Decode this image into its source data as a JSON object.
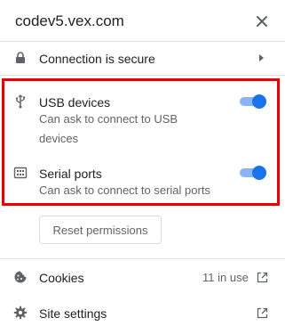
{
  "header": {
    "site": "codev5.vex.com"
  },
  "connection": {
    "label": "Connection is secure"
  },
  "permissions": [
    {
      "label": "USB devices",
      "description_line1": "Can ask to connect to USB",
      "description_line2": "devices",
      "enabled": true,
      "icon": "usb-icon"
    },
    {
      "label": "Serial ports",
      "description_line1": "Can ask to connect to serial ports",
      "enabled": true,
      "icon": "serial-port-icon"
    }
  ],
  "reset": {
    "label": "Reset permissions"
  },
  "cookies": {
    "label": "Cookies",
    "count": "11 in use",
    "icon": "cookie-icon"
  },
  "site_settings": {
    "label": "Site settings",
    "icon": "gear-icon"
  },
  "colors": {
    "highlight": "#ea0000",
    "toggle_on": "#1a73e8",
    "toggle_track": "#8ab4f8"
  }
}
